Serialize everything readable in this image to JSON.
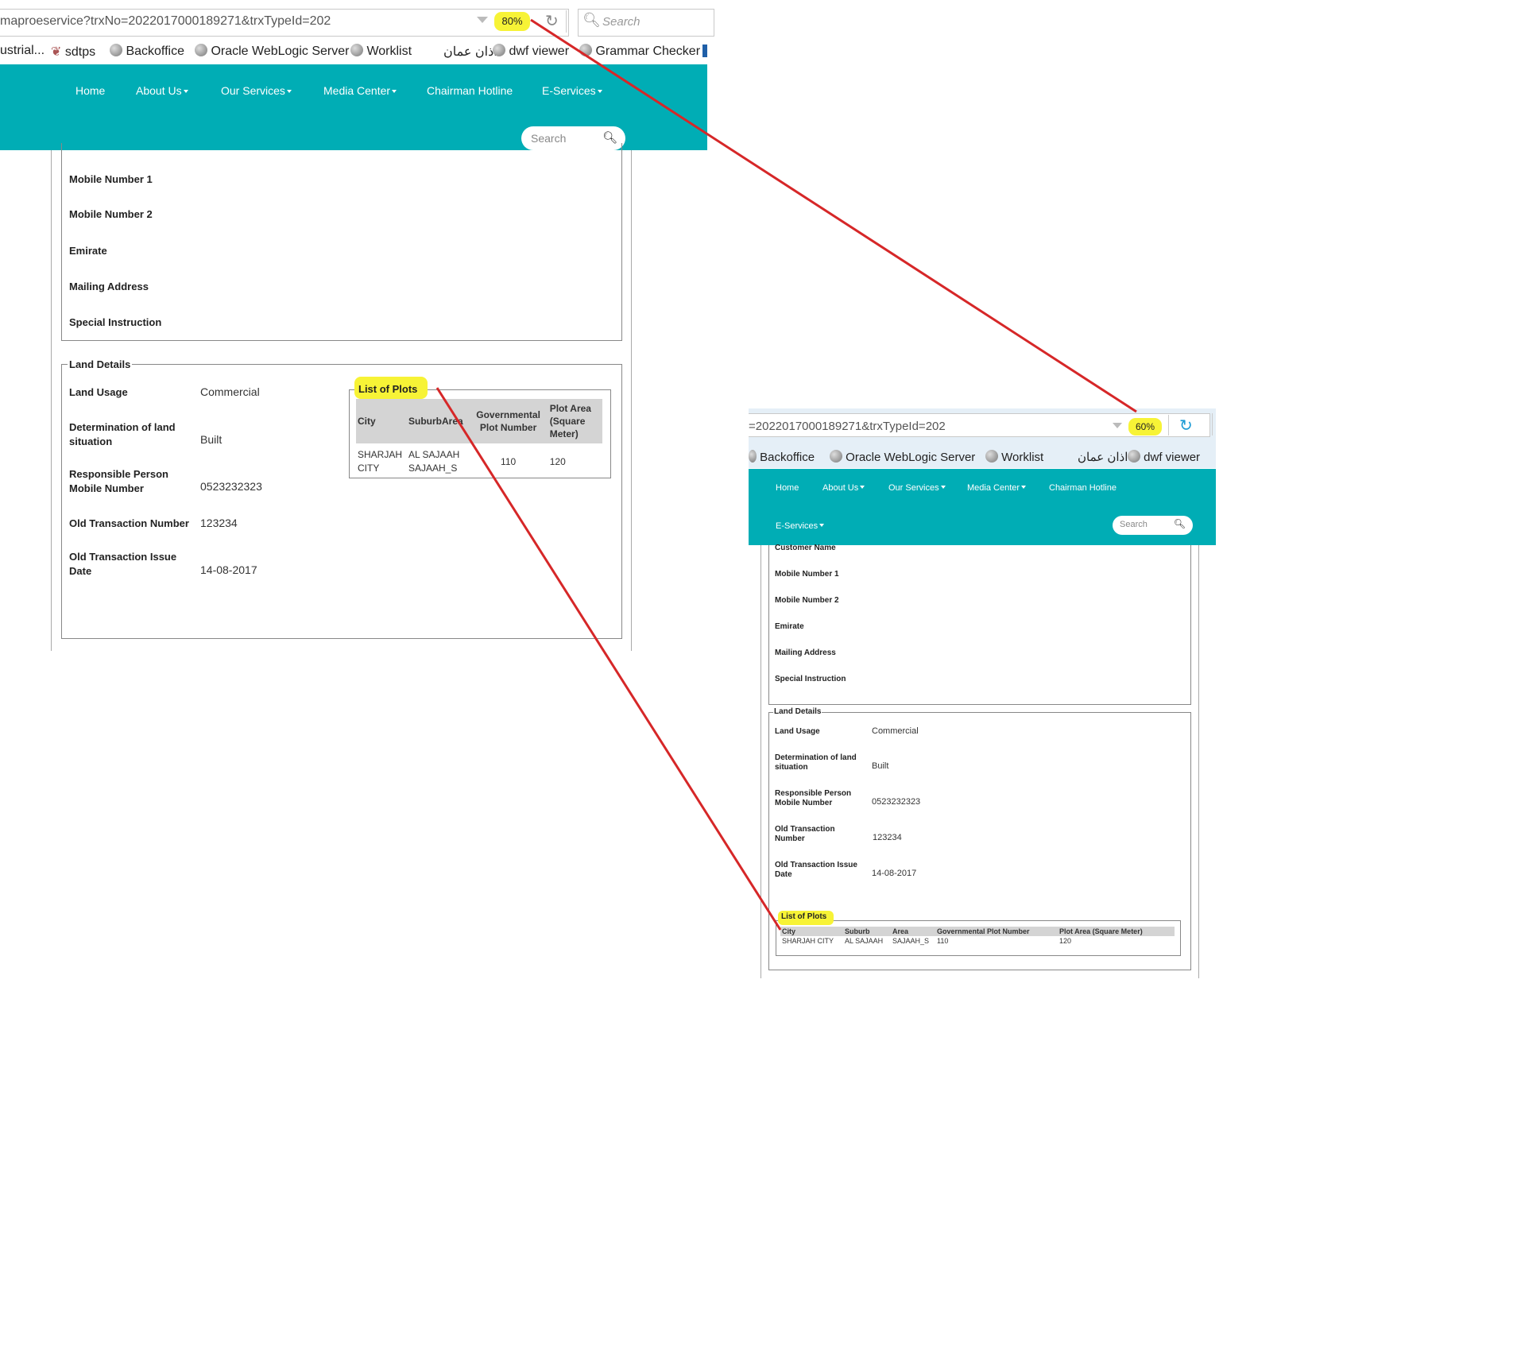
{
  "left": {
    "zoom": "80%",
    "url": "maproeservice?trxNo=2022017000189271&trxTypeId=202",
    "search_placeholder": "Search",
    "bookmarks": [
      "ustrial...",
      "sdtps",
      "Backoffice",
      "Oracle WebLogic Server",
      "Worklist",
      "اذان عمان",
      "dwf viewer",
      "Grammar Checker"
    ],
    "nav": [
      "Home",
      "About Us",
      "Our Services",
      "Media Center",
      "Chairman Hotline",
      "E-Services"
    ],
    "nav_search": "Search",
    "customer_fields": [
      "Mobile Number 1",
      "Mobile Number 2",
      "Emirate",
      "Mailing Address",
      "Special Instruction"
    ],
    "land_title": "Land Details",
    "land": [
      {
        "label": "Land Usage",
        "value": "Commercial"
      },
      {
        "label": "Determination of land situation",
        "value": "Built"
      },
      {
        "label": "Responsible Person Mobile Number",
        "value": "0523232323"
      },
      {
        "label": "Old Transaction Number",
        "value": "123234"
      },
      {
        "label": "Old Transaction Issue Date",
        "value": "14-08-2017"
      }
    ],
    "plots_title": "List of Plots",
    "plots_headers": [
      "City",
      "Suburb",
      "Area",
      "Governmental Plot Number",
      "Plot Area (Square Meter)"
    ],
    "plots_row": [
      "SHARJAH CITY",
      "AL SAJAAH",
      "SAJAAH_S",
      "110",
      "120"
    ]
  },
  "right": {
    "zoom": "60%",
    "url": "=2022017000189271&trxTypeId=202",
    "bookmarks": [
      "Backoffice",
      "Oracle WebLogic Server",
      "Worklist",
      "اذان عمان",
      "dwf viewer"
    ],
    "nav": [
      "Home",
      "About Us",
      "Our Services",
      "Media Center",
      "Chairman Hotline",
      "E-Services"
    ],
    "nav_search": "Search",
    "customer_fields": [
      "Customer Name",
      "Mobile Number 1",
      "Mobile Number 2",
      "Emirate",
      "Mailing Address",
      "Special Instruction"
    ],
    "land_title": "Land Details",
    "land": [
      {
        "label": "Land Usage",
        "value": "Commercial"
      },
      {
        "label": "Determination of land situation",
        "value": "Built"
      },
      {
        "label": "Responsible Person Mobile Number",
        "value": "0523232323"
      },
      {
        "label": "Old Transaction Number",
        "value": "123234"
      },
      {
        "label": "Old Transaction Issue Date",
        "value": "14-08-2017"
      }
    ],
    "plots_title": "List of Plots",
    "plots_headers": [
      "City",
      "Suburb",
      "Area",
      "Governmental Plot Number",
      "Plot Area (Square Meter)"
    ],
    "plots_row": [
      "SHARJAH CITY",
      "AL SAJAAH",
      "SAJAAH_S",
      "110",
      "120"
    ]
  },
  "colors": {
    "nav_bg": "#00adb5",
    "highlight": "#f7f336",
    "annotation_line": "#d62728"
  }
}
